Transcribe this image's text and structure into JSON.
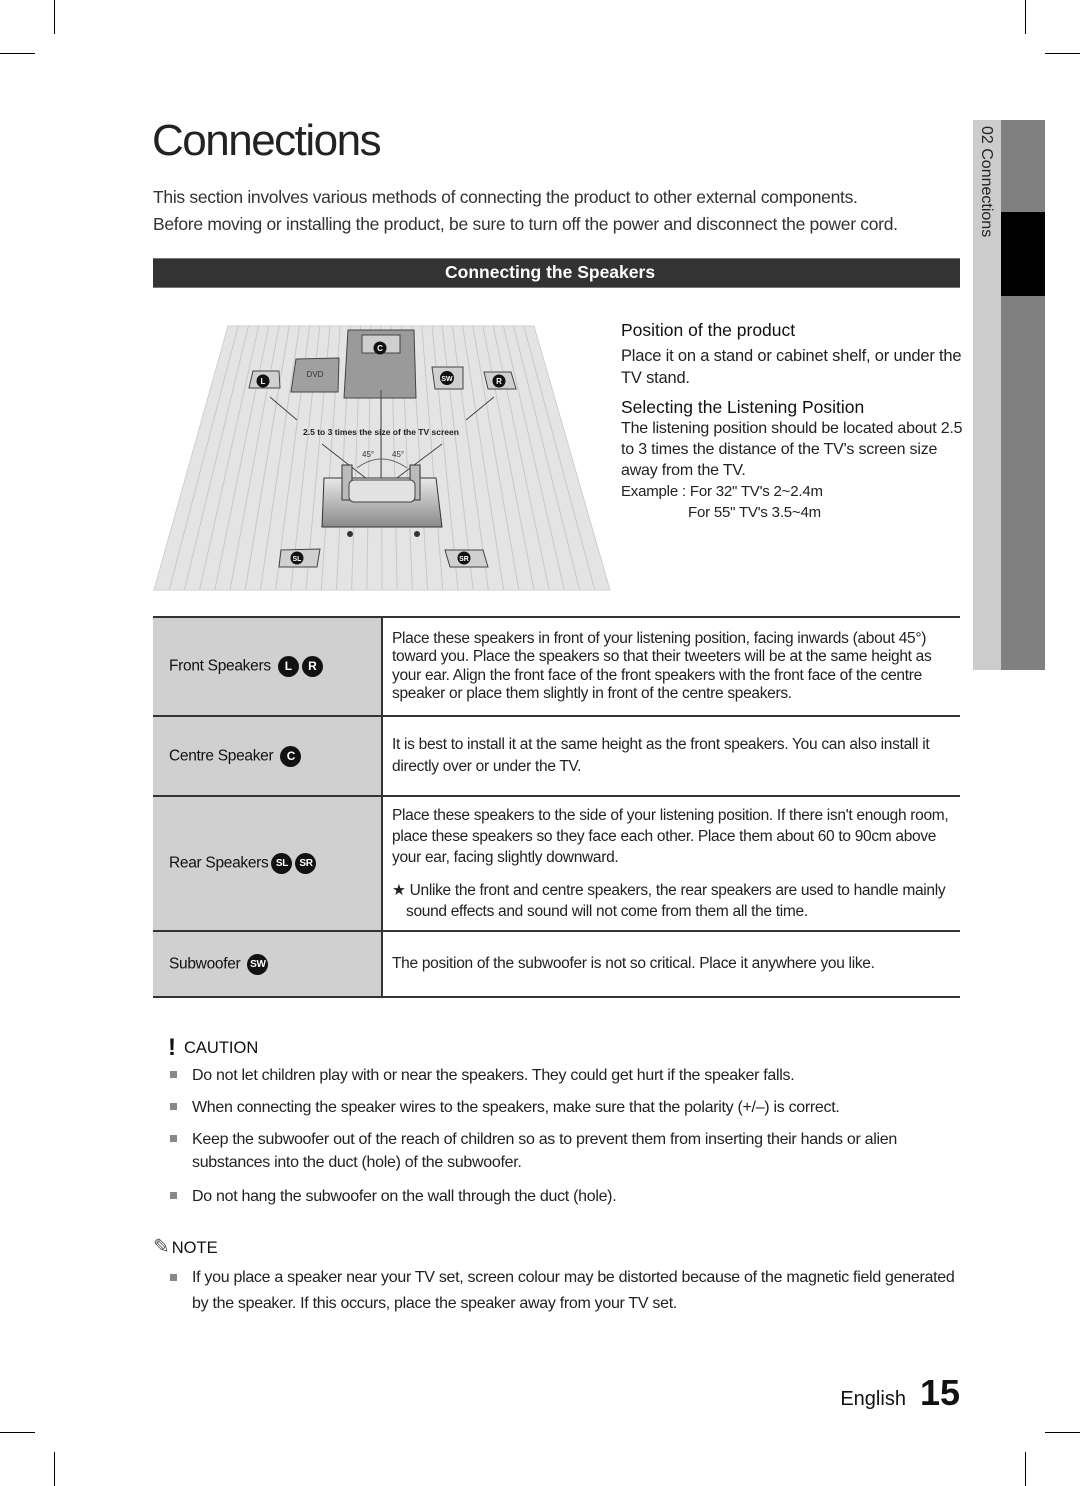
{
  "page": {
    "title": "Connections",
    "intro_lines": [
      "This section involves various methods of connecting the product to other external components.",
      "Before moving or installing the product, be sure to turn off the power and disconnect the power cord."
    ],
    "section_heading": "Connecting the Speakers"
  },
  "diagram": {
    "labels": {
      "center": "C",
      "front_left": "L",
      "front_right": "R",
      "subwoofer": "SW",
      "surround_left": "SL",
      "surround_right": "SR",
      "player": "DVD"
    },
    "distance_caption": "2.5 to 3 times the size of the TV screen",
    "angle_left": "45°",
    "angle_right": "45°"
  },
  "position_info": {
    "product_heading": "Position of the product",
    "product_text": "Place it on a stand or cabinet shelf, or under the TV stand.",
    "listening_heading": "Selecting the Listening Position",
    "listening_text": "The listening position should be located about 2.5 to 3 times the distance of the TV's screen size away from the TV.",
    "example_1": "Example : For 32\" TV's 2~2.4m",
    "example_2": "For 55\" TV's 3.5~4m"
  },
  "speaker_table": {
    "rows": [
      {
        "label": "Front Speakers",
        "badges": [
          "L",
          "R"
        ],
        "description": "Place these speakers in front of your listening position, facing inwards (about 45°) toward you. Place the speakers so that their tweeters will be at the same height as your ear. Align the front face of the front speakers with the front face of the centre speaker or place them slightly in front of the centre speakers."
      },
      {
        "label": "Centre Speaker",
        "badges": [
          "C"
        ],
        "description": "It is best to install it at the same height as the front speakers. You can also install it directly over or under the TV."
      },
      {
        "label": "Rear Speakers",
        "badges": [
          "SL",
          "SR"
        ],
        "description": "Place these speakers to the side of your listening position. If there isn't enough room, place these speakers so they face each other. Place them about 60 to 90cm above your ear, facing slightly downward.",
        "footnote": "★ Unlike the front and centre speakers, the rear speakers are used to handle mainly sound effects and sound will not come from them all the time."
      },
      {
        "label": "Subwoofer",
        "badges": [
          "SW"
        ],
        "description": "The position of the subwoofer is not so critical. Place it anywhere you like."
      }
    ]
  },
  "caution": {
    "icon": "exclamation-icon",
    "heading": "CAUTION",
    "items": [
      "Do not let children play with or near the speakers. They could get hurt if the speaker falls.",
      "When connecting the speaker wires to the speakers, make sure that the polarity (+/–) is correct.",
      "Keep the subwoofer out of the reach of children so as to prevent them from inserting their hands or alien substances into the duct (hole) of the subwoofer.",
      "Do not hang the subwoofer on the wall through the duct (hole)."
    ]
  },
  "note": {
    "icon": "pencil-icon",
    "heading": "NOTE",
    "items": [
      "If you place a speaker near your TV set, screen colour may be distorted because of the magnetic field generated by the speaker. If this occurs, place the speaker away from your TV set."
    ]
  },
  "footer": {
    "language": "English",
    "page_number": "15"
  },
  "side_tab": {
    "chapter_number": "02",
    "chapter_name": "Connections",
    "text": "02  Connections"
  }
}
